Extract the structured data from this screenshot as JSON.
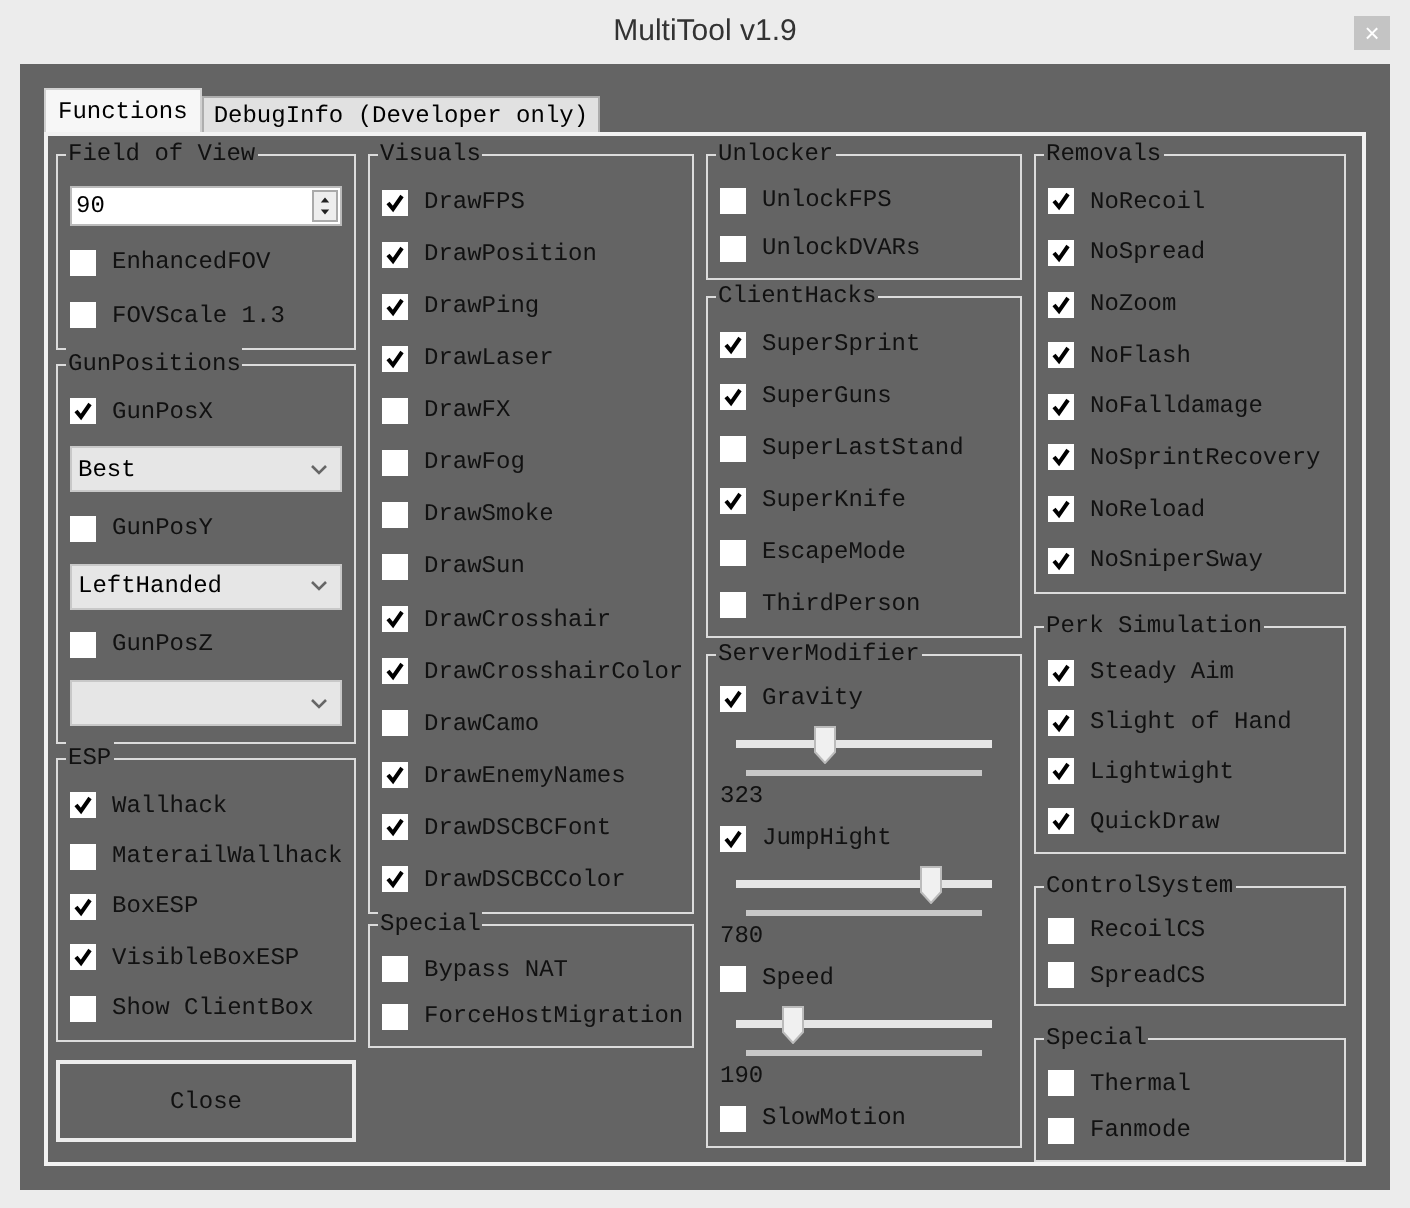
{
  "window": {
    "title": "MultiTool v1.9",
    "close": "×"
  },
  "tabs": [
    {
      "label": "Functions",
      "selected": true
    },
    {
      "label": "DebugInfo (Developer only)",
      "selected": false
    }
  ],
  "columns": [
    {
      "groups": [
        {
          "title": "Field of View",
          "items": [
            {
              "kind": "number",
              "value": "90"
            },
            {
              "kind": "checkbox",
              "label": "EnhancedFOV",
              "checked": false
            },
            {
              "kind": "checkbox",
              "label": "FOVScale 1.3",
              "checked": false
            }
          ]
        },
        {
          "title": "GunPositions",
          "items": [
            {
              "kind": "checkbox",
              "label": "GunPosX",
              "checked": true
            },
            {
              "kind": "select",
              "value": "Best"
            },
            {
              "kind": "checkbox",
              "label": "GunPosY",
              "checked": false
            },
            {
              "kind": "select",
              "value": "LeftHanded"
            },
            {
              "kind": "checkbox",
              "label": "GunPosZ",
              "checked": false
            },
            {
              "kind": "select"
            }
          ]
        },
        {
          "title": "ESP",
          "items": [
            {
              "kind": "checkbox",
              "label": "Wallhack",
              "checked": true
            },
            {
              "kind": "checkbox",
              "label": "MaterailWallhack",
              "checked": false
            },
            {
              "kind": "checkbox",
              "label": "BoxESP",
              "checked": true
            },
            {
              "kind": "checkbox",
              "label": "VisibleBoxESP",
              "checked": true
            },
            {
              "kind": "checkbox",
              "label": "Show ClientBox",
              "checked": false
            }
          ]
        }
      ],
      "button": "Close"
    },
    {
      "groups": [
        {
          "title": "Visuals",
          "items": [
            {
              "kind": "checkbox",
              "label": "DrawFPS",
              "checked": true
            },
            {
              "kind": "checkbox",
              "label": "DrawPosition",
              "checked": true
            },
            {
              "kind": "checkbox",
              "label": "DrawPing",
              "checked": true
            },
            {
              "kind": "checkbox",
              "label": "DrawLaser",
              "checked": true
            },
            {
              "kind": "checkbox",
              "label": "DrawFX",
              "checked": false
            },
            {
              "kind": "checkbox",
              "label": "DrawFog",
              "checked": false
            },
            {
              "kind": "checkbox",
              "label": "DrawSmoke",
              "checked": false
            },
            {
              "kind": "checkbox",
              "label": "DrawSun",
              "checked": false
            },
            {
              "kind": "checkbox",
              "label": "DrawCrosshair",
              "checked": true
            },
            {
              "kind": "checkbox",
              "label": "DrawCrosshairColor",
              "checked": true
            },
            {
              "kind": "checkbox",
              "label": "DrawCamo",
              "checked": false
            },
            {
              "kind": "checkbox",
              "label": "DrawEnemyNames",
              "checked": true
            },
            {
              "kind": "checkbox",
              "label": "DrawDSCBCFont",
              "checked": true
            },
            {
              "kind": "checkbox",
              "label": "DrawDSCBCColor",
              "checked": true
            }
          ]
        },
        {
          "title": "Special",
          "items": [
            {
              "kind": "checkbox",
              "label": "Bypass NAT",
              "checked": false
            },
            {
              "kind": "checkbox",
              "label": "ForceHostMigration",
              "checked": false
            }
          ]
        }
      ]
    },
    {
      "groups": [
        {
          "title": "Unlocker",
          "items": [
            {
              "kind": "checkbox",
              "label": "UnlockFPS",
              "checked": false
            },
            {
              "kind": "checkbox",
              "label": "UnlockDVARs",
              "checked": false
            }
          ]
        },
        {
          "title": "ClientHacks",
          "items": [
            {
              "kind": "checkbox",
              "label": "SuperSprint",
              "checked": true
            },
            {
              "kind": "checkbox",
              "label": "SuperGuns",
              "checked": true
            },
            {
              "kind": "checkbox",
              "label": "SuperLastStand",
              "checked": false
            },
            {
              "kind": "checkbox",
              "label": "SuperKnife",
              "checked": true
            },
            {
              "kind": "checkbox",
              "label": "EscapeMode",
              "checked": false
            },
            {
              "kind": "checkbox",
              "label": "ThirdPerson",
              "checked": false
            }
          ]
        },
        {
          "title": "ServerModifier",
          "items": [
            {
              "kind": "checkbox",
              "label": "Gravity",
              "checked": true
            },
            {
              "kind": "slider",
              "level": 0.34,
              "reading": "323"
            },
            {
              "kind": "checkbox",
              "label": "JumpHight",
              "checked": true
            },
            {
              "kind": "slider",
              "level": 0.76,
              "reading": "780"
            },
            {
              "kind": "checkbox",
              "label": "Speed",
              "checked": false
            },
            {
              "kind": "slider",
              "level": 0.22,
              "reading": "190"
            },
            {
              "kind": "checkbox",
              "label": "SlowMotion",
              "checked": false
            }
          ]
        }
      ]
    },
    {
      "groups": [
        {
          "title": "Removals",
          "items": [
            {
              "kind": "checkbox",
              "label": "NoRecoil",
              "checked": true
            },
            {
              "kind": "checkbox",
              "label": "NoSpread",
              "checked": true
            },
            {
              "kind": "checkbox",
              "label": "NoZoom",
              "checked": true
            },
            {
              "kind": "checkbox",
              "label": "NoFlash",
              "checked": true
            },
            {
              "kind": "checkbox",
              "label": "NoFalldamage",
              "checked": true
            },
            {
              "kind": "checkbox",
              "label": "NoSprintRecovery",
              "checked": true
            },
            {
              "kind": "checkbox",
              "label": "NoReload",
              "checked": true
            },
            {
              "kind": "checkbox",
              "label": "NoSniperSway",
              "checked": true
            }
          ]
        },
        {
          "title": "Perk Simulation",
          "items": [
            {
              "kind": "checkbox",
              "label": "Steady Aim",
              "checked": true
            },
            {
              "kind": "checkbox",
              "label": "Slight of Hand",
              "checked": true
            },
            {
              "kind": "checkbox",
              "label": "Lightwight",
              "checked": true
            },
            {
              "kind": "checkbox",
              "label": "QuickDraw",
              "checked": true
            }
          ]
        },
        {
          "title": "ControlSystem",
          "items": [
            {
              "kind": "checkbox",
              "label": "RecoilCS",
              "checked": false
            },
            {
              "kind": "checkbox",
              "label": "SpreadCS",
              "checked": false
            }
          ]
        },
        {
          "title": "Special",
          "items": [
            {
              "kind": "checkbox",
              "label": "Thermal",
              "checked": false
            },
            {
              "kind": "checkbox",
              "label": "Fanmode",
              "checked": false
            }
          ]
        }
      ]
    }
  ]
}
